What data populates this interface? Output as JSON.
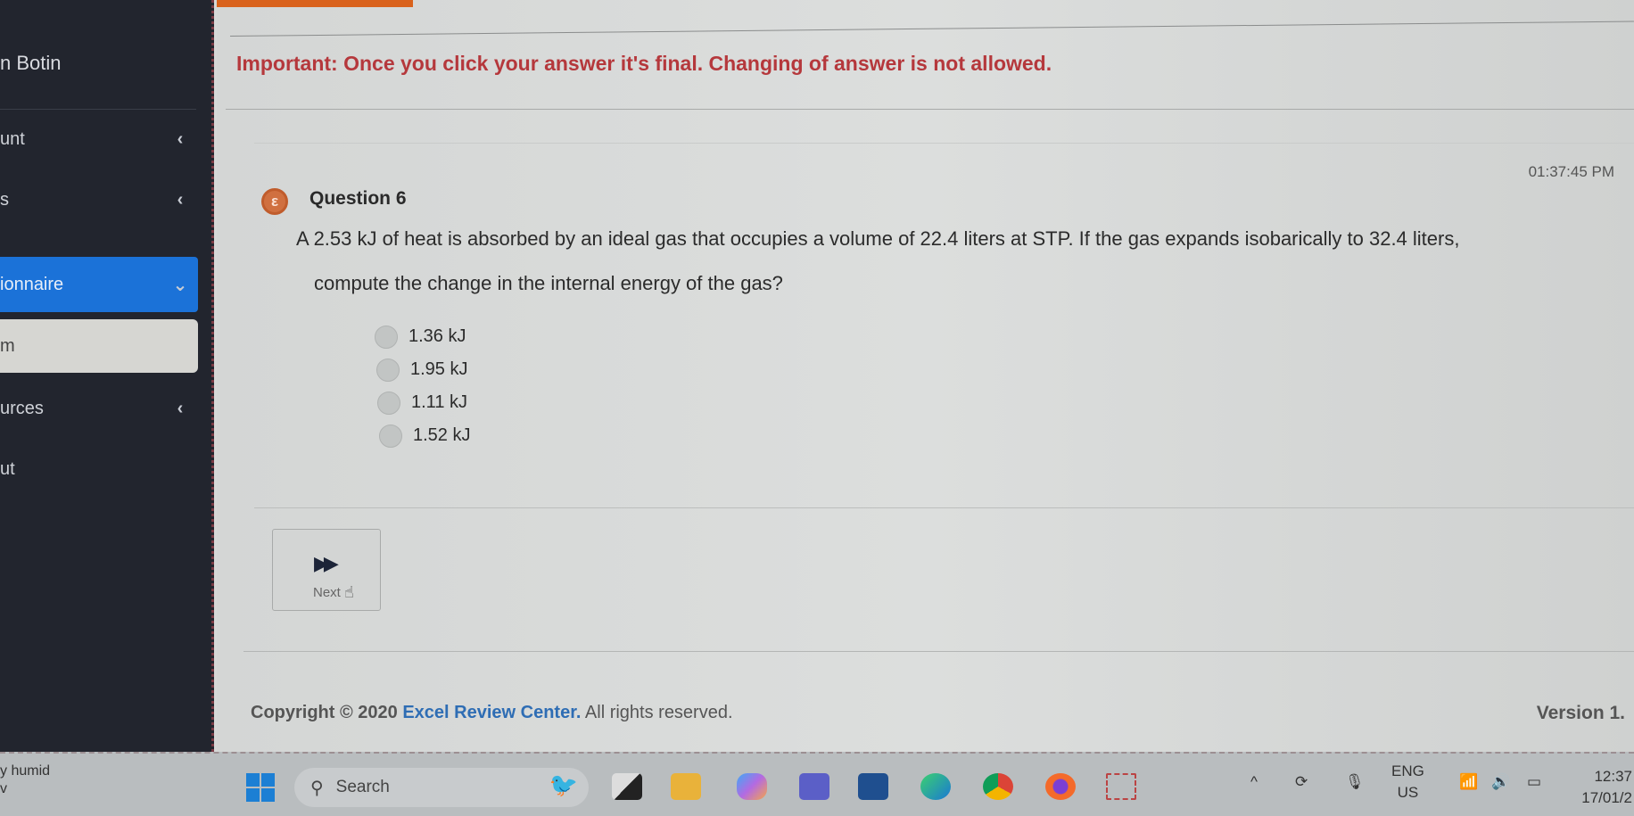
{
  "sidebar": {
    "user": "n Botin",
    "items": [
      {
        "label": "unt",
        "chevron": "‹"
      },
      {
        "label": "s",
        "chevron": "‹"
      },
      {
        "label": "ionnaire",
        "chevron": "⌄"
      },
      {
        "label": "m"
      },
      {
        "label": "urces",
        "chevron": "‹"
      },
      {
        "label": "ut"
      }
    ]
  },
  "notice": "Important: Once you click your answer it's final. Changing of answer is not allowed.",
  "question": {
    "time": "01:37:45 PM",
    "icon_glyph": "ε",
    "title": "Question 6",
    "text_line1": "A 2.53 kJ of heat is absorbed by an ideal gas that occupies a volume of 22.4 liters at STP. If the gas expands isobarically to 32.4 liters,",
    "text_line2": "compute the change in the internal energy of the gas?",
    "options": [
      "1.36 kJ",
      "1.95 kJ",
      "1.11 kJ",
      "1.52 kJ"
    ]
  },
  "next": {
    "icon": "▶▶",
    "label": "Next"
  },
  "footer": {
    "prefix": "Copyright © 2020 ",
    "brand": "Excel Review Center.",
    "suffix": " All rights reserved.",
    "version": "Version 1."
  },
  "taskbar": {
    "weather_line1": "y humid",
    "weather_line2": "v",
    "search_label": "Search",
    "lang_line1": "ENG",
    "lang_line2": "US",
    "clock_time": "12:37",
    "clock_date": "17/01/2"
  },
  "colors": {
    "accent_blue": "#1b72d8",
    "notice_red": "#b5383c",
    "brand_blue": "#2e6db4",
    "question_icon": "#d07040"
  }
}
